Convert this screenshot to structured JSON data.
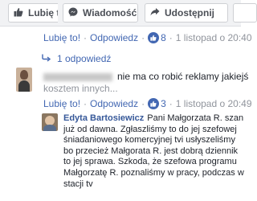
{
  "toolbar": {
    "like": "Lubię to!",
    "message": "Wiadomość",
    "share": "Udostępnij"
  },
  "comment_meta_top": {
    "like": "Lubię to!",
    "reply": "Odpowiedz",
    "like_count": "8",
    "timestamp": "1 listopad o 20:40"
  },
  "replies_link": "1 odpowiedź",
  "comment1": {
    "text_line1": "nie ma co robić reklamy jakiejś",
    "text_line2": "kosztem innych...",
    "meta": {
      "like": "Lubię to!",
      "reply": "Odpowiedz",
      "like_count": "3",
      "timestamp": "1 listopad o 20:49"
    }
  },
  "reply": {
    "author": "Edyta Bartosiewicz",
    "lines": [
      "Pani Małgorzata R. szan",
      "już od dawna. Zgłaszliśmy to do jej szefowej",
      "śniadaniowego komercyjnej tvi usłyszeliśmy",
      "bo przecież Małgorata R. jest dobrą dziennik",
      "to jej sprawa. Szkoda, że szefowa programu",
      "Małgorzatę R. poznaliśmy w pracy, podczas w",
      "stacji tv"
    ]
  },
  "icons": {
    "like": "thumbs-up-icon",
    "message": "messenger-icon",
    "share": "share-arrow-icon",
    "replies_arrow": "reply-arrow-icon",
    "like_badge": "like-badge-icon"
  },
  "colors": {
    "link": "#4267b2",
    "meta_gray": "#90949c",
    "author": "#365899"
  }
}
